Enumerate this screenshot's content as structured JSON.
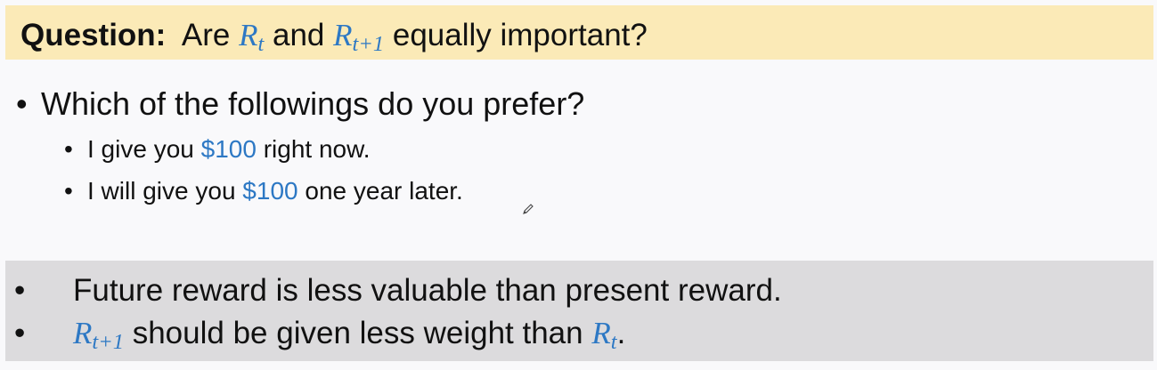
{
  "question": {
    "label": "Question:",
    "before": "Are",
    "var1": "R",
    "var1_sub": "t",
    "middle": "and",
    "var2": "R",
    "var2_sub": "t+1",
    "after": "equally important?"
  },
  "main_bullet": "Which of the followings do you prefer?",
  "options": [
    {
      "before": "I give you",
      "amount": "$100",
      "after": "right now."
    },
    {
      "before": "I will give you",
      "amount": "$100",
      "after": "one year later."
    }
  ],
  "conclusions": {
    "line1": "Future reward is less valuable than present reward.",
    "line2": {
      "var1": "R",
      "var1_sub": "t+1",
      "text": "should be given less weight than",
      "var2": "R",
      "var2_sub": "t",
      "end": "."
    }
  },
  "colors": {
    "accent": "#2d78c4",
    "question_bg": "#fbeab7",
    "conclusion_bg": "#dcdbdd"
  },
  "icons": [
    "pencil-cursor-icon"
  ]
}
